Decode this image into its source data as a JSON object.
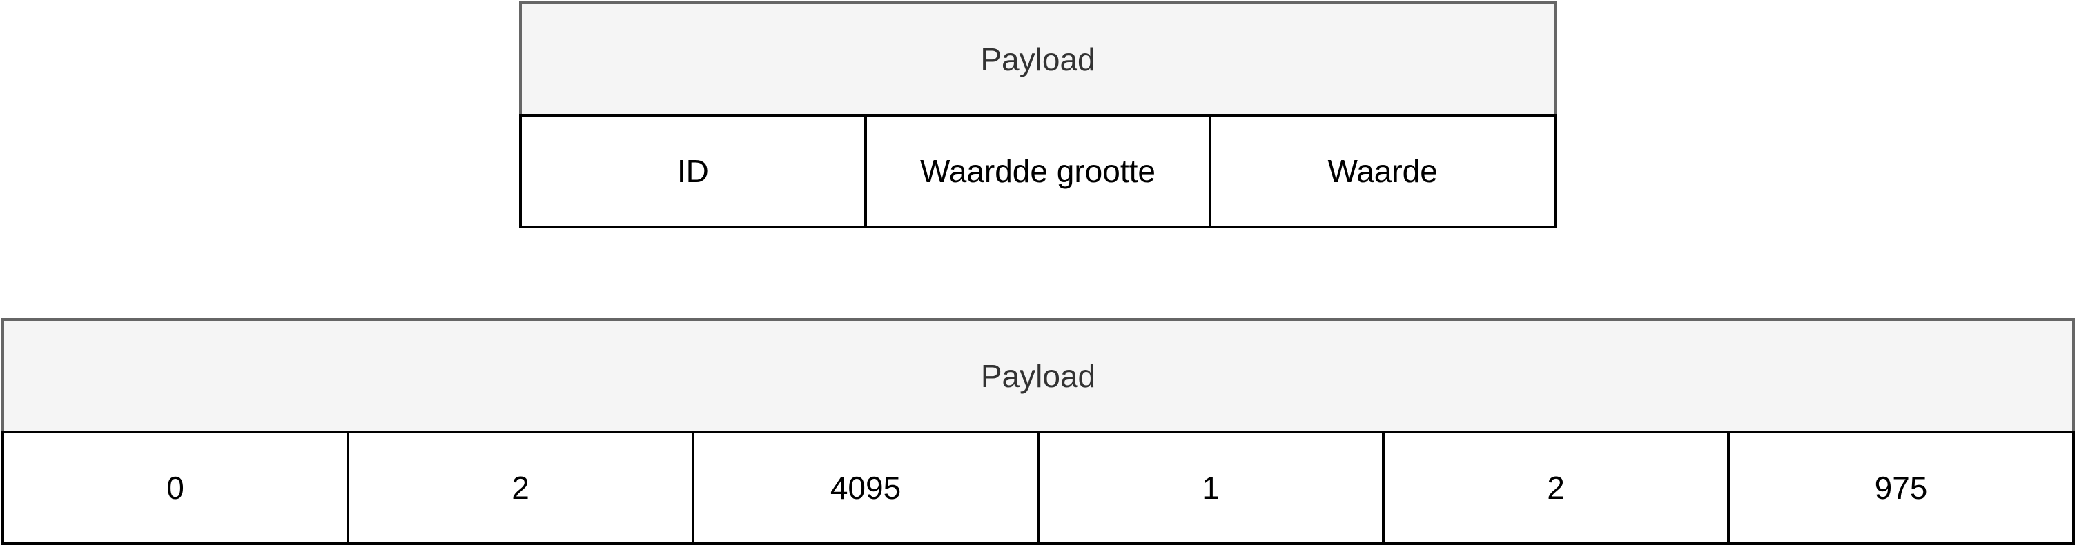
{
  "diagram_top": {
    "header": "Payload",
    "cells": [
      "ID",
      "Waardde grootte",
      "Waarde"
    ]
  },
  "diagram_bottom": {
    "header": "Payload",
    "cells": [
      "0",
      "2",
      "4095",
      "1",
      "2",
      "975"
    ]
  },
  "colors": {
    "header_fill": "#f5f5f5",
    "header_border": "#666666",
    "cell_border": "#000000",
    "header_text": "#333333",
    "cell_text": "#000000"
  }
}
